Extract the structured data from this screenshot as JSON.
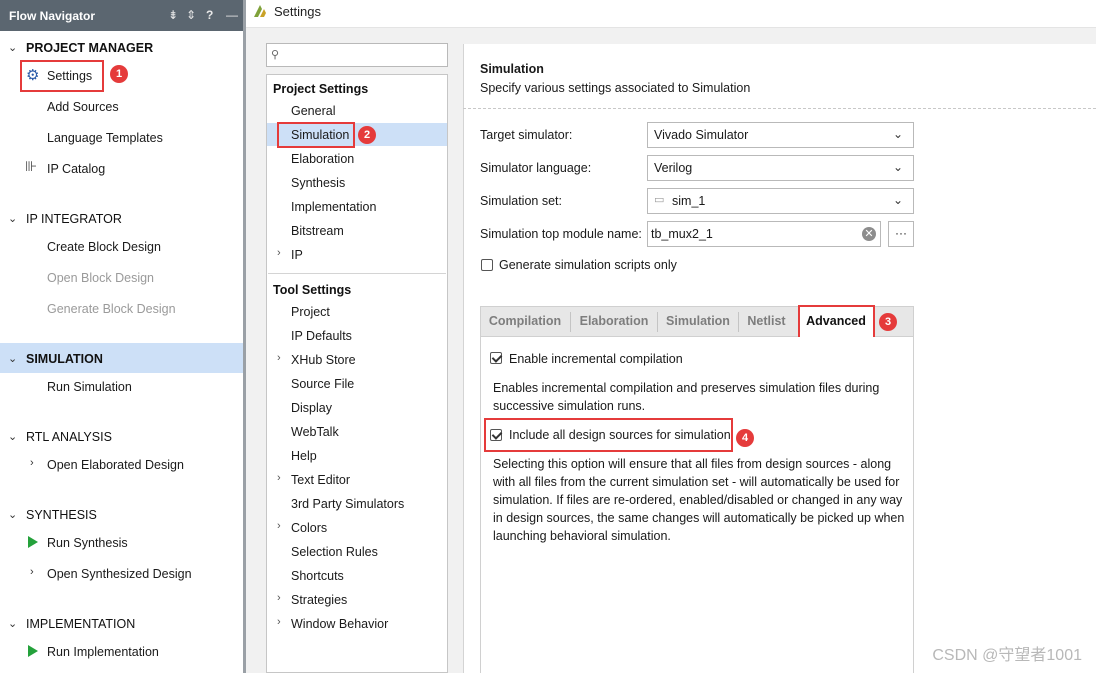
{
  "flow_navigator": {
    "title": "Flow Navigator",
    "header_icons": [
      "collapse-all-icon",
      "expand-all-icon",
      "help-icon",
      "minimize-icon"
    ],
    "header_glyphs": [
      "⇟",
      "⇕",
      "?",
      "—"
    ],
    "sections": {
      "project_manager": {
        "title": "PROJECT MANAGER",
        "items": [
          "Settings",
          "Add Sources",
          "Language Templates",
          "IP Catalog"
        ]
      },
      "ip_integrator": {
        "title": "IP INTEGRATOR",
        "items": [
          "Create Block Design",
          "Open Block Design",
          "Generate Block Design"
        ]
      },
      "simulation": {
        "title": "SIMULATION",
        "items": [
          "Run Simulation"
        ]
      },
      "rtl_analysis": {
        "title": "RTL ANALYSIS",
        "items": [
          "Open Elaborated Design"
        ]
      },
      "synthesis": {
        "title": "SYNTHESIS",
        "items": [
          "Run Synthesis",
          "Open Synthesized Design"
        ]
      },
      "implementation": {
        "title": "IMPLEMENTATION",
        "items": [
          "Run Implementation"
        ]
      }
    }
  },
  "settings": {
    "title": "Settings",
    "search_placeholder": "",
    "project_settings": {
      "title": "Project Settings",
      "items": [
        "General",
        "Simulation",
        "Elaboration",
        "Synthesis",
        "Implementation",
        "Bitstream",
        "IP"
      ]
    },
    "tool_settings": {
      "title": "Tool Settings",
      "items": [
        "Project",
        "IP Defaults",
        "XHub Store",
        "Source File",
        "Display",
        "WebTalk",
        "Help",
        "Text Editor",
        "3rd Party Simulators",
        "Colors",
        "Selection Rules",
        "Shortcuts",
        "Strategies",
        "Window Behavior"
      ]
    },
    "panel": {
      "title": "Simulation",
      "subtitle": "Specify various settings associated to Simulation",
      "target_simulator": {
        "label": "Target simulator:",
        "value": "Vivado Simulator"
      },
      "simulator_language": {
        "label": "Simulator language:",
        "value": "Verilog"
      },
      "simulation_set": {
        "label": "Simulation set:",
        "value": "sim_1"
      },
      "top_module": {
        "label": "Simulation top module name:",
        "value": "tb_mux2_1",
        "browse": "···"
      },
      "generate_scripts_only": {
        "label": "Generate simulation scripts only",
        "checked": false
      },
      "tabs": [
        "Compilation",
        "Elaboration",
        "Simulation",
        "Netlist",
        "Advanced"
      ],
      "active_tab": "Advanced",
      "advanced": {
        "enable_incremental": {
          "label": "Enable incremental compilation",
          "checked": true,
          "desc": [
            "Enables incremental compilation and preserves simulation files during",
            "successive simulation runs."
          ]
        },
        "include_all_sources": {
          "label": "Include all design sources for simulation",
          "checked": true,
          "desc": [
            "Selecting this option will ensure that all files from design sources - along",
            "with all files from the current simulation set - will automatically be used for",
            "simulation. If files are re-ordered, enabled/disabled or changed in any way",
            "in design sources, the same changes will automatically be picked up when",
            "launching behavioral simulation."
          ]
        }
      }
    }
  },
  "annotations": [
    "1",
    "2",
    "3",
    "4"
  ],
  "watermark": "CSDN @守望者1001",
  "colors": {
    "header": "#5b6670",
    "selected": "#cde0f7",
    "annotation": "#e53b3b",
    "run_icon": "#24a13b"
  }
}
